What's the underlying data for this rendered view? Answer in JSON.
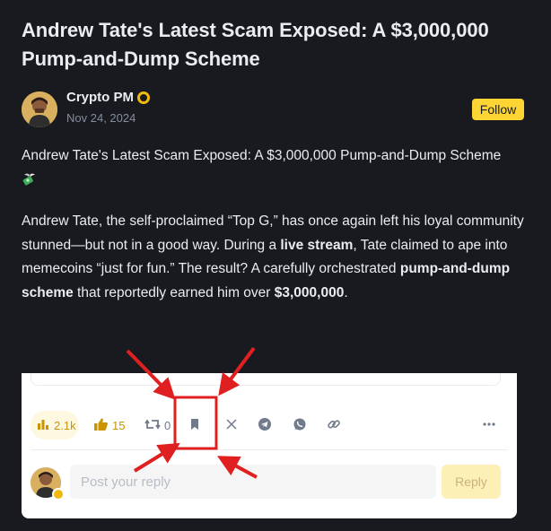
{
  "article": {
    "title": "Andrew Tate's Latest Scam Exposed: A $3,000,000 Pump-and-Dump Scheme",
    "author": {
      "name": "Crypto PM",
      "date": "Nov 24, 2024"
    },
    "follow_label": "Follow",
    "intro": "Andrew Tate's Latest Scam Exposed: A $3,000,000 Pump-and-Dump Scheme",
    "paragraph": {
      "p1": "Andrew Tate, the self-proclaimed “Top G,” has once again left his loyal community stunned—but not in a good way. During a ",
      "b1": "live stream",
      "p2": ", Tate claimed to ape into memecoins “just for fun.” The result? A carefully orchestrated ",
      "b2": "pump-and-dump scheme",
      "p3": " that reportedly earned him over ",
      "b3": "$3,000,000",
      "p4": "."
    }
  },
  "actions": {
    "views": "2.1k",
    "likes": "15",
    "reposts": "0",
    "icons": [
      "views-icon",
      "thumbs-up-icon",
      "repost-icon",
      "bookmark-icon",
      "x-icon",
      "telegram-icon",
      "whatsapp-icon",
      "link-icon",
      "more-icon"
    ]
  },
  "reply": {
    "placeholder": "Post your reply",
    "button_label": "Reply"
  },
  "colors": {
    "background": "#181a20",
    "accent": "#fcd535",
    "annotation": "#e02020"
  }
}
